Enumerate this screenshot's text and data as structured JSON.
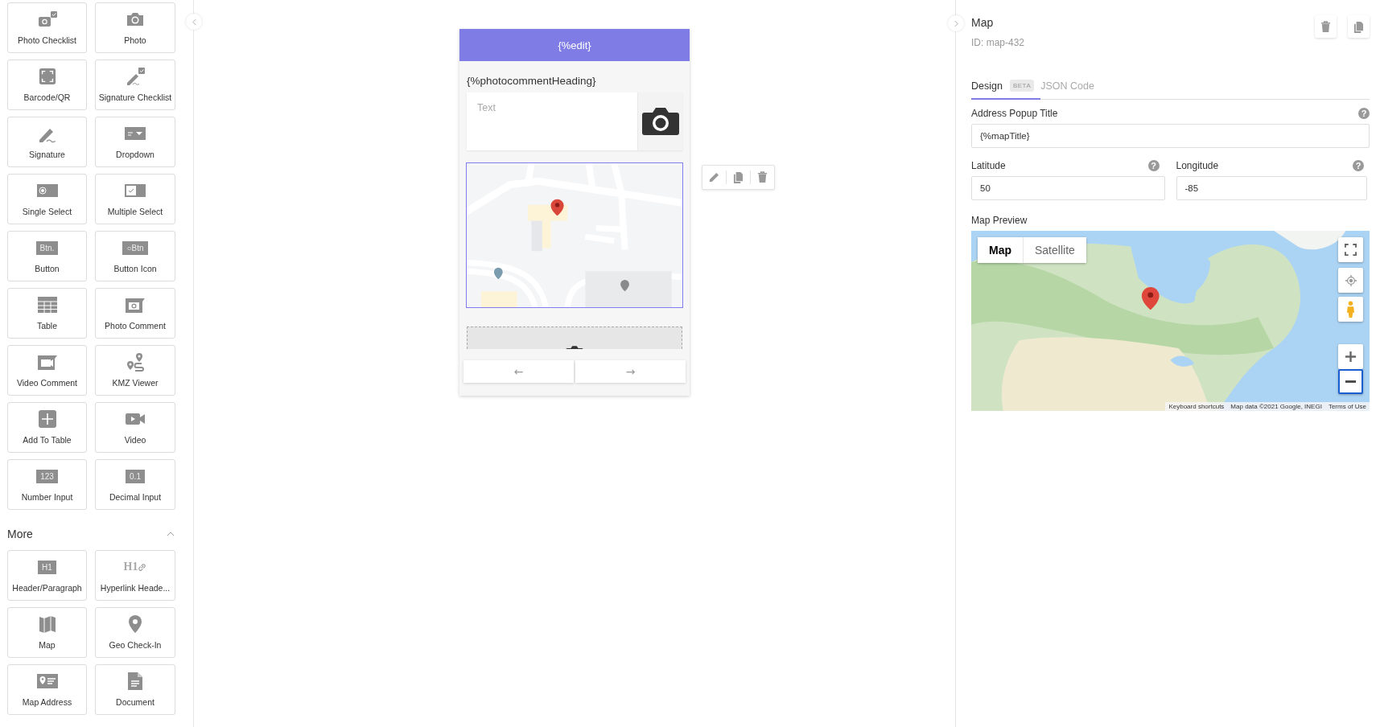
{
  "palette": {
    "tiles": [
      {
        "label": "Photo Checklist",
        "kind": "photo-checklist"
      },
      {
        "label": "Photo",
        "kind": "camera"
      },
      {
        "label": "Barcode/QR",
        "kind": "scan"
      },
      {
        "label": "Signature Checklist",
        "kind": "signature-checklist"
      },
      {
        "label": "Signature",
        "kind": "signature"
      },
      {
        "label": "Dropdown",
        "kind": "dropdown"
      },
      {
        "label": "Single Select",
        "kind": "radio"
      },
      {
        "label": "Multiple Select",
        "kind": "checkbox"
      },
      {
        "label": "Button",
        "kind": "text-chip",
        "icon_text": "Btn."
      },
      {
        "label": "Button Icon",
        "kind": "text-chip",
        "icon_text": "○Btn"
      },
      {
        "label": "Table",
        "kind": "table"
      },
      {
        "label": "Photo Comment",
        "kind": "photo-comment"
      },
      {
        "label": "Video Comment",
        "kind": "video-comment"
      },
      {
        "label": "KMZ Viewer",
        "kind": "route"
      },
      {
        "label": "Add To Table",
        "kind": "plus"
      },
      {
        "label": "Video",
        "kind": "video"
      },
      {
        "label": "Number Input",
        "kind": "text-chip",
        "icon_text": "123"
      },
      {
        "label": "Decimal Input",
        "kind": "text-chip",
        "icon_text": "0.1"
      }
    ],
    "more": {
      "title": "More",
      "expanded": true,
      "tiles": [
        {
          "label": "Header/Paragraph",
          "kind": "text-chip",
          "icon_text": "H1"
        },
        {
          "label": "Hyperlink Heade...",
          "kind": "text-link",
          "icon_text": "H1"
        },
        {
          "label": "Map",
          "kind": "map"
        },
        {
          "label": "Geo Check-In",
          "kind": "pin"
        },
        {
          "label": "Map Address",
          "kind": "map-address"
        },
        {
          "label": "Document",
          "kind": "document"
        }
      ]
    }
  },
  "canvas": {
    "header": "{%edit}",
    "components": [
      {
        "kind": "photo_comment",
        "heading": "{%photocommentHeading}",
        "placeholder": "Text"
      },
      {
        "kind": "map",
        "selected": true
      },
      {
        "kind": "photo_dropzone"
      }
    ],
    "nav_buttons": [
      "←",
      "→"
    ]
  },
  "inspector": {
    "title": "Map",
    "id": "ID: map-432",
    "tabs": [
      {
        "label": "Design",
        "badge": "BETA",
        "selected": true
      },
      {
        "label": "JSON Code",
        "selected": false
      }
    ],
    "address_title": {
      "label": "Address Popup Title",
      "value": "{%mapTitle}",
      "help": "?"
    },
    "coordinates": [
      {
        "label": "Latitude",
        "value": "50",
        "help": "?"
      },
      {
        "label": "Longitude",
        "value": "-85",
        "help": "?"
      }
    ],
    "map_preview": {
      "label": "Map Preview",
      "map_types": [
        {
          "label": "Map",
          "selected": true
        },
        {
          "label": "Satellite",
          "selected": false
        }
      ],
      "attribution": [
        "Keyboard shortcuts",
        "Map data ©2021 Google, INEGI",
        "Terms of Use"
      ]
    }
  }
}
